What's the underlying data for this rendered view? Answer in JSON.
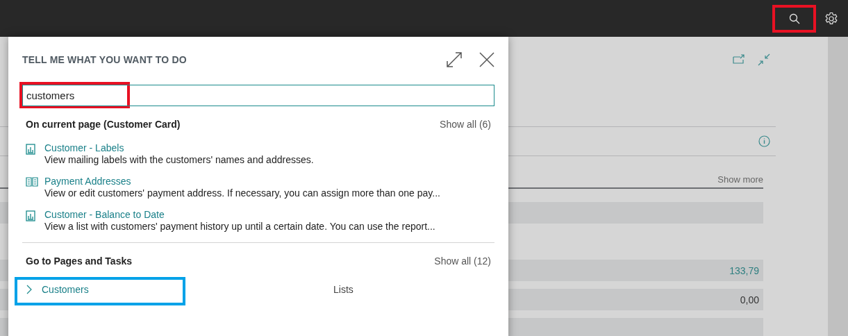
{
  "top_bar": {
    "search_highlighted": true
  },
  "background_page": {
    "show_more": "Show more",
    "fields": [
      {
        "kind": "bar"
      },
      {
        "kind": "link",
        "value": "133,79"
      },
      {
        "kind": "value",
        "value": "0,00"
      },
      {
        "kind": "bar"
      }
    ]
  },
  "dialog": {
    "title": "TELL ME WHAT YOU WANT TO DO",
    "search": {
      "value": "customers",
      "highlighted": true
    },
    "sections": [
      {
        "heading": "On current page (Customer Card)",
        "show_all": "Show all (6)",
        "items": [
          {
            "kind": "report",
            "title": "Customer - Labels",
            "description": "View mailing labels with the customers' names and addresses."
          },
          {
            "kind": "page",
            "title": "Payment Addresses",
            "description": "View or edit customers' payment address. If necessary, you can assign more than one pay..."
          },
          {
            "kind": "report",
            "title": "Customer - Balance to Date",
            "description": "View a list with customers' payment history up until a certain date. You can use the report..."
          }
        ]
      },
      {
        "heading": "Go to Pages and Tasks",
        "show_all": "Show all (12)",
        "items": [
          {
            "kind": "nav",
            "title": "Customers",
            "category": "Lists",
            "highlighted": true
          }
        ]
      }
    ]
  }
}
